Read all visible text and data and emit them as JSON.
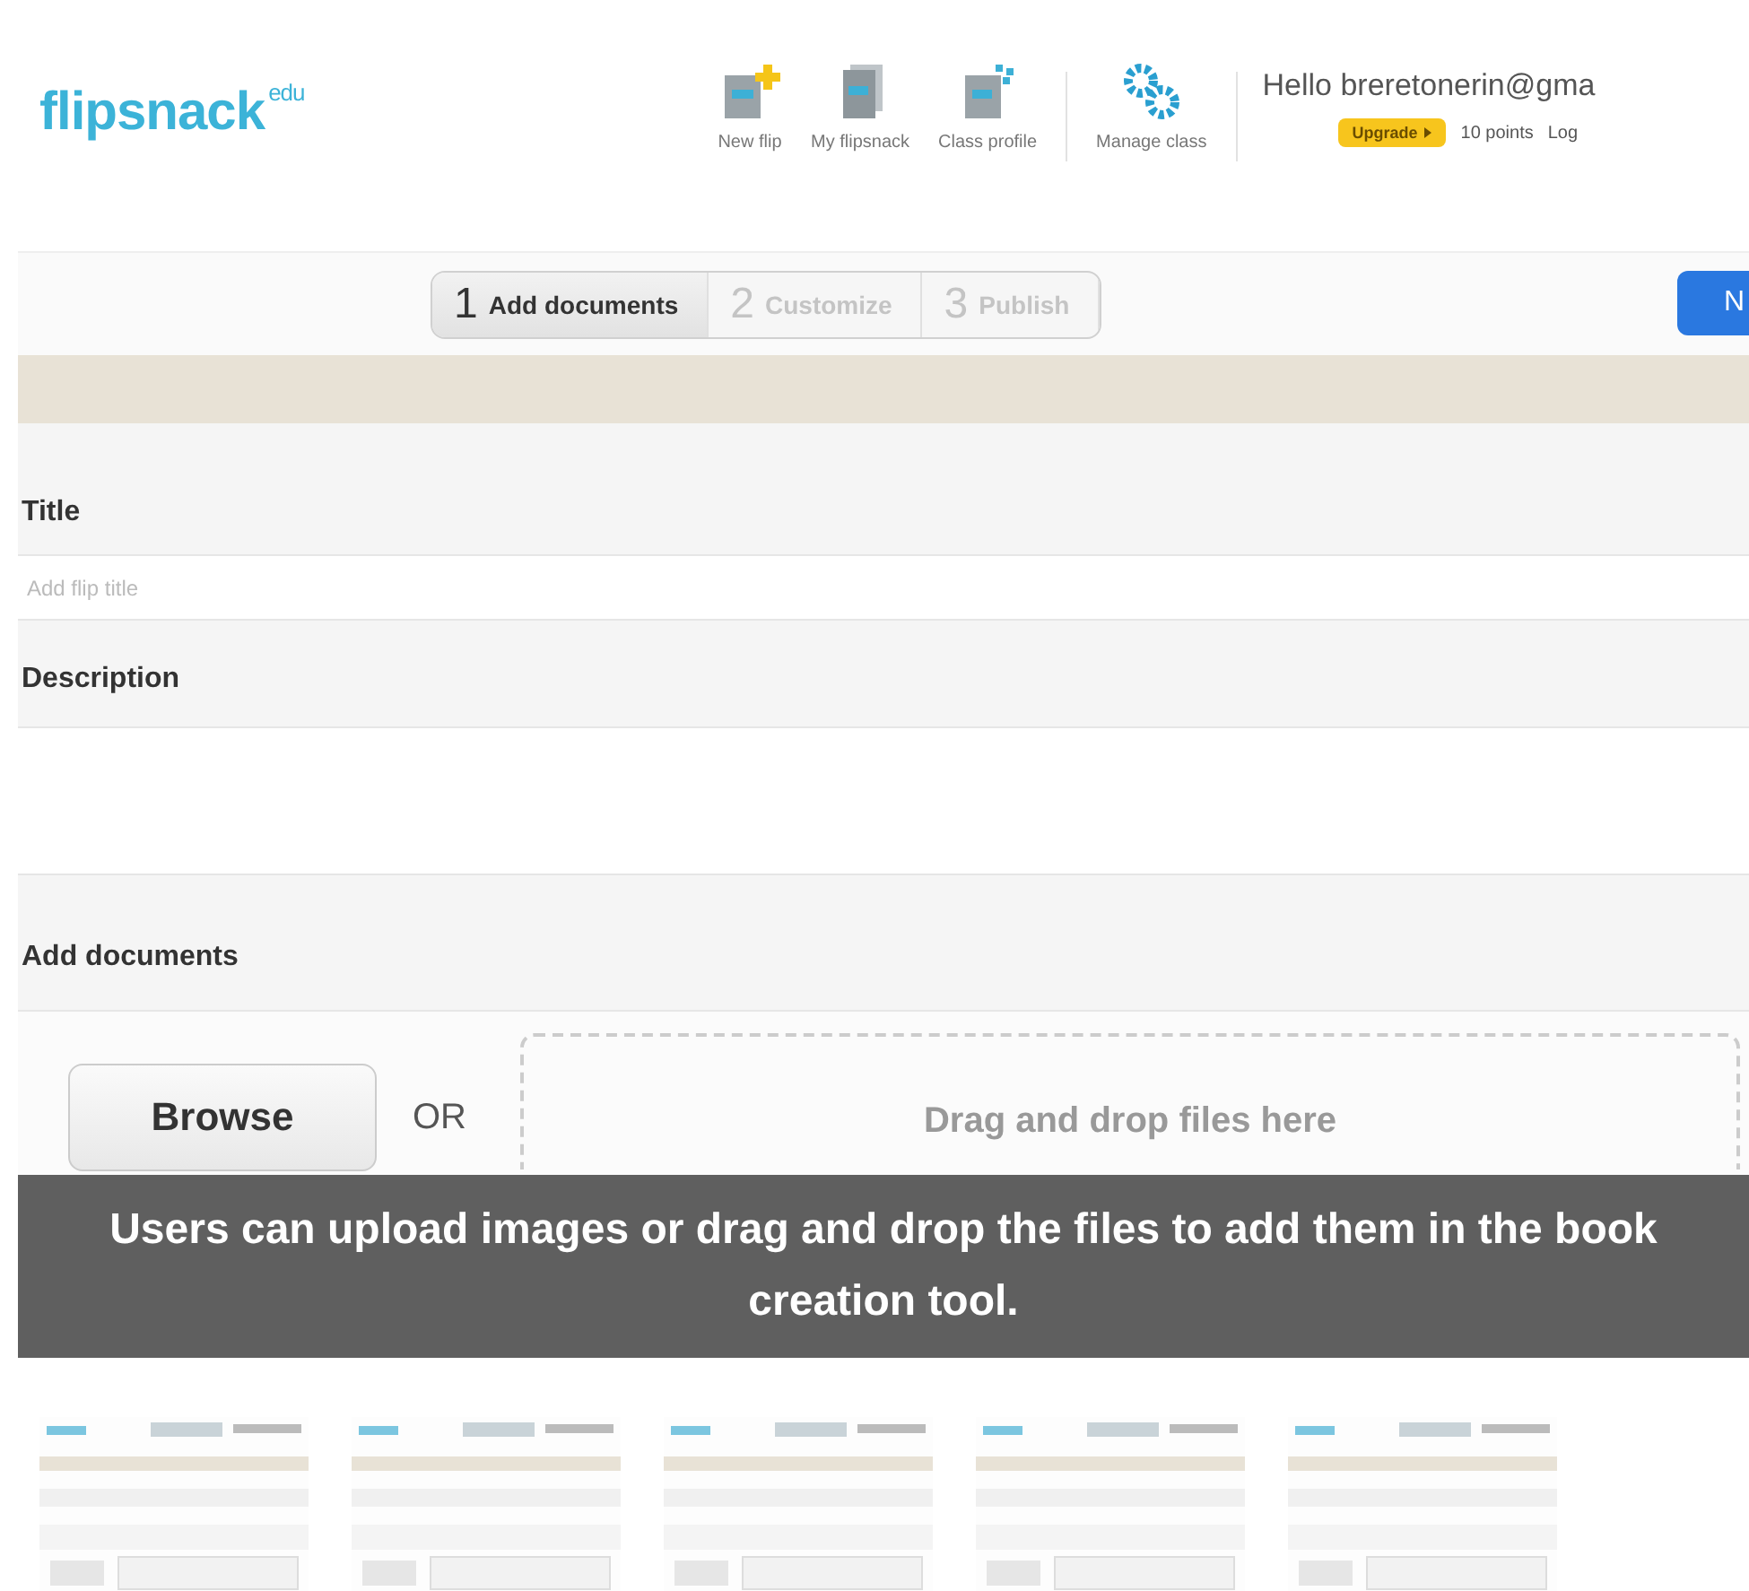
{
  "header": {
    "logo": "flipsnack",
    "logo_sup": "edu",
    "nav": [
      {
        "kind": "new",
        "label": "New flip"
      },
      {
        "kind": "stack",
        "label": "My flipsnack"
      },
      {
        "kind": "profile",
        "label": "Class profile"
      },
      {
        "kind": "gears",
        "label": "Manage class"
      }
    ],
    "greeting": "Hello breretonerin@gma",
    "upgrade": "Upgrade",
    "points": "10 points",
    "logout": "Log"
  },
  "steps": [
    {
      "number": "1",
      "label": "Add documents",
      "selected": true
    },
    {
      "number": "2",
      "label": "Customize",
      "selected": false
    },
    {
      "number": "3",
      "label": "Publish",
      "selected": false
    }
  ],
  "next_button": "N",
  "form": {
    "title_label": "Title",
    "title_placeholder": "Add flip title",
    "description_label": "Description",
    "documents_label": "Add documents",
    "browse": "Browse",
    "or": "OR",
    "dropzone": "Drag and drop files here"
  },
  "caption": "Users can upload images or drag and drop the files to add them in the book creation tool."
}
